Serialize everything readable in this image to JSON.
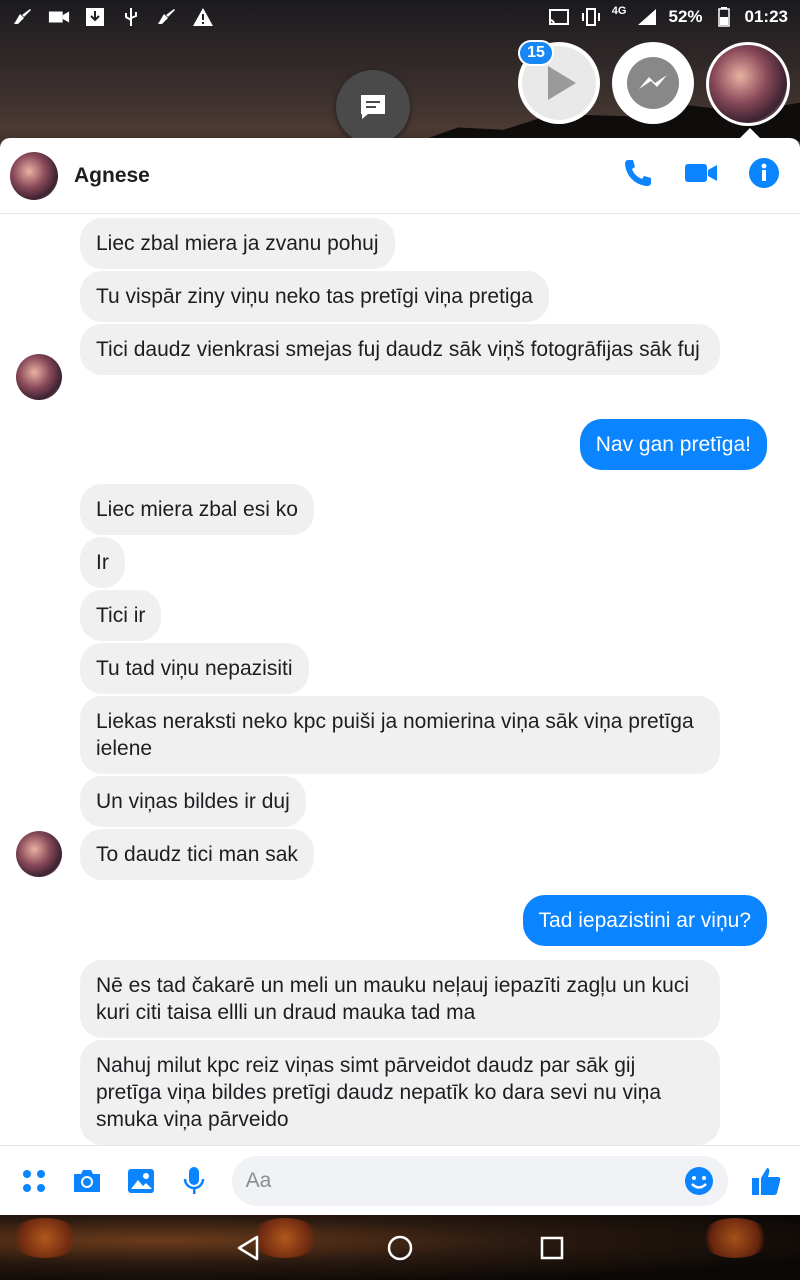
{
  "status_bar": {
    "battery": "52%",
    "time": "01:23",
    "network": "4G",
    "left_icons": [
      "broom-icon",
      "video-camera-icon",
      "download-icon",
      "usb-icon",
      "broom-icon",
      "warning-icon"
    ],
    "right_icons": [
      "cast-icon",
      "vibrate-icon",
      "signal-icon",
      "battery-icon"
    ]
  },
  "chat_heads": {
    "badge_count": "15"
  },
  "header": {
    "name": "Agnese",
    "actions": [
      "phone-icon",
      "video-icon",
      "info-icon"
    ]
  },
  "colors": {
    "accent": "#0a84ff",
    "incoming_bubble": "#f0f0f1"
  },
  "messages": [
    {
      "dir": "in",
      "text": "Liec zbal miera ja zvanu pohuj"
    },
    {
      "dir": "in",
      "text": "Tu vispār ziny viņu neko tas pretīgi viņa pretiga"
    },
    {
      "dir": "in",
      "text": "Tici daudz vienkrasi smejas  fuj daudz sāk viņš fotogrāfijas sāk fuj"
    },
    {
      "dir": "out",
      "text": "Nav gan pretīga!"
    },
    {
      "dir": "in",
      "text": "Liec miera zbal esi ko"
    },
    {
      "dir": "in",
      "text": "Ir"
    },
    {
      "dir": "in",
      "text": "Tici ir"
    },
    {
      "dir": "in",
      "text": "Tu tad viņu nepazisiti"
    },
    {
      "dir": "in",
      "text": "Liekas neraksti neko kpc puiši ja nomierina  viņa sāk viņa pretīga ielene"
    },
    {
      "dir": "in",
      "text": "Un viņas bildes ir duj"
    },
    {
      "dir": "in",
      "text": "To daudz tici man sak"
    },
    {
      "dir": "out",
      "text": "Tad iepazistini ar viņu?"
    },
    {
      "dir": "in",
      "text": "Nē es tad čakarē un meli un mauku neļauj iepazīti zagļu un kuci kuri citi taisa ellli un draud mauka tad ma"
    },
    {
      "dir": "in",
      "text": "Nahuj milut kpc reiz viņas simt pārveidot daudz par sāk gij pretīga viņa bildes pretīgi daudz nepatīk ko dara sevi nu viņa smuka viņa pārveido"
    }
  ],
  "composer": {
    "placeholder": "Aa",
    "icons": [
      "apps-icon",
      "camera-icon",
      "gallery-icon",
      "microphone-icon",
      "emoji-icon",
      "thumbs-up-icon"
    ]
  }
}
